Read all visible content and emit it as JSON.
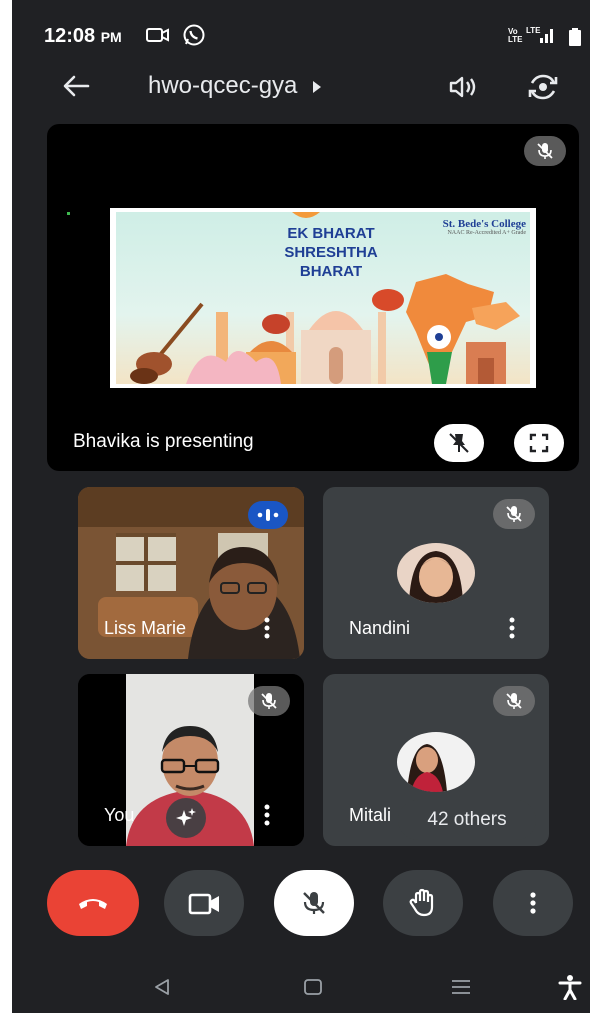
{
  "status_bar": {
    "time": "12:08",
    "ampm": "PM",
    "icons": [
      "video-cam-icon",
      "whatsapp-icon",
      "volte-icon",
      "lte-signal-icon",
      "battery-icon"
    ],
    "volte_label": "Vo LTE",
    "lte_label": "LTE"
  },
  "app_bar": {
    "meeting_code": "hwo-qcec-gya",
    "icons": [
      "back-arrow-icon",
      "chevron-right-icon",
      "speaker-icon",
      "switch-camera-icon"
    ]
  },
  "presentation": {
    "label": "Bhavika is presenting",
    "slide": {
      "heading_line1": "EK BHARAT",
      "heading_line2": "SHRESHTHA",
      "heading_line3": "BHARAT",
      "college": "St. Bede's College",
      "college_sub": "NAAC Re-Accredited A+ Grade"
    }
  },
  "participants": [
    {
      "name": "Liss Marie",
      "speaking": true,
      "muted": false
    },
    {
      "name": "Nandini",
      "speaking": false,
      "muted": true
    },
    {
      "name": "You",
      "speaking": false,
      "muted": true
    },
    {
      "name": "Mitali",
      "speaking": false,
      "muted": true
    }
  ],
  "others_label": "42 others",
  "controls": {
    "icons": [
      "end-call-icon",
      "camera-icon",
      "mic-off-icon",
      "raise-hand-icon",
      "more-options-icon"
    ],
    "colors": {
      "end_call": "#ea4335",
      "default": "#3c4043",
      "active": "#ffffff"
    }
  },
  "nav_bar": {
    "icons": [
      "nav-back-icon",
      "nav-home-icon",
      "nav-recents-icon",
      "accessibility-icon"
    ]
  },
  "colors": {
    "background": "#202124",
    "tile": "#3c4043",
    "speaking_badge": "#1a56c4"
  }
}
